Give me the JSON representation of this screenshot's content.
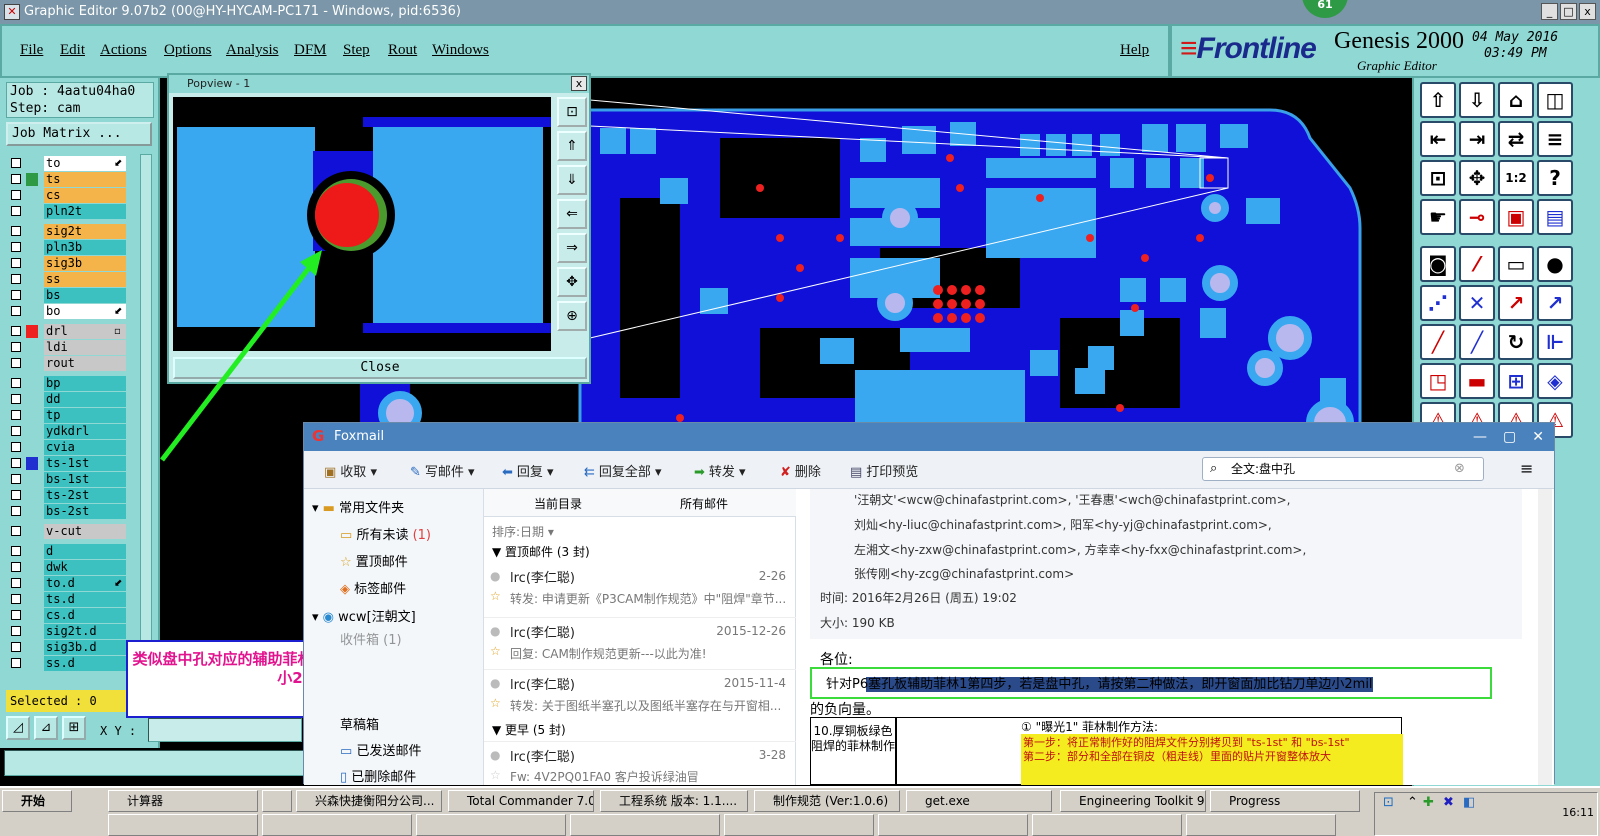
{
  "window": {
    "title": "Graphic Editor 9.07b2 (00@HY-HYCAM-PC171 - Windows, pid:6536)",
    "badge": "61",
    "controls": [
      "_",
      "□",
      "x"
    ]
  },
  "menu": {
    "items": [
      "File",
      "Edit",
      "Actions",
      "Options",
      "Analysis",
      "DFM",
      "Step",
      "Rout",
      "Windows"
    ],
    "help": "Help"
  },
  "brand": {
    "logo_main": "Frontline",
    "product": "Genesis 2000",
    "subtitle": "Graphic Editor",
    "date": "04 May 2016",
    "time": "03:49 PM"
  },
  "left": {
    "job": "Job : 4aatu04ha0",
    "step": "Step: cam",
    "job_matrix": "Job Matrix ...",
    "layers": [
      {
        "name": "to",
        "bg": "#ffffff",
        "swatch": "",
        "mark": "⬋"
      },
      {
        "name": "ts",
        "bg": "#f4b44a",
        "swatch": "#2e9a46",
        "mark": ""
      },
      {
        "name": "cs",
        "bg": "#f4b44a",
        "swatch": "",
        "mark": ""
      },
      {
        "name": "pln2t",
        "bg": "#3cc0c0",
        "swatch": "",
        "mark": ""
      },
      {
        "name": "sig2t",
        "bg": "#f4b44a",
        "swatch": "",
        "mark": ""
      },
      {
        "name": "pln3b",
        "bg": "#3cc0c0",
        "swatch": "",
        "mark": ""
      },
      {
        "name": "sig3b",
        "bg": "#f4b44a",
        "swatch": "",
        "mark": ""
      },
      {
        "name": "ss",
        "bg": "#f4b44a",
        "swatch": "",
        "mark": ""
      },
      {
        "name": "bs",
        "bg": "#3cc0c0",
        "swatch": "",
        "mark": ""
      },
      {
        "name": "bo",
        "bg": "#ffffff",
        "swatch": "",
        "mark": "⬋"
      },
      {
        "name": "drl",
        "bg": "#c8c8c8",
        "swatch": "#ee2020",
        "mark": "▫"
      },
      {
        "name": "ldi",
        "bg": "#c8c8c8",
        "swatch": "",
        "mark": ""
      },
      {
        "name": "rout",
        "bg": "#c8c8c8",
        "swatch": "",
        "mark": ""
      },
      {
        "name": "bp",
        "bg": "#3cc0c0",
        "swatch": "",
        "mark": ""
      },
      {
        "name": "dd",
        "bg": "#3cc0c0",
        "swatch": "",
        "mark": ""
      },
      {
        "name": "tp",
        "bg": "#3cc0c0",
        "swatch": "",
        "mark": ""
      },
      {
        "name": "ydkdrl",
        "bg": "#3cc0c0",
        "swatch": "",
        "mark": ""
      },
      {
        "name": "cvia",
        "bg": "#3cc0c0",
        "swatch": "",
        "mark": ""
      },
      {
        "name": "ts-1st",
        "bg": "#3cc0c0",
        "swatch": "#2030d0",
        "mark": ""
      },
      {
        "name": "bs-1st",
        "bg": "#3cc0c0",
        "swatch": "",
        "mark": ""
      },
      {
        "name": "ts-2st",
        "bg": "#3cc0c0",
        "swatch": "",
        "mark": ""
      },
      {
        "name": "bs-2st",
        "bg": "#3cc0c0",
        "swatch": "",
        "mark": ""
      },
      {
        "name": "v-cut",
        "bg": "#c8c8c8",
        "swatch": "",
        "mark": ""
      },
      {
        "name": "d",
        "bg": "#3cc0c0",
        "swatch": "",
        "mark": ""
      },
      {
        "name": "dwk",
        "bg": "#3cc0c0",
        "swatch": "",
        "mark": ""
      },
      {
        "name": "to.d",
        "bg": "#3cc0c0",
        "swatch": "",
        "mark": "⬋"
      },
      {
        "name": "ts.d",
        "bg": "#3cc0c0",
        "swatch": "",
        "mark": ""
      },
      {
        "name": "cs.d",
        "bg": "#3cc0c0",
        "swatch": "",
        "mark": ""
      },
      {
        "name": "sig2t.d",
        "bg": "#3cc0c0",
        "swatch": "",
        "mark": ""
      },
      {
        "name": "sig3b.d",
        "bg": "#3cc0c0",
        "swatch": "",
        "mark": ""
      },
      {
        "name": "ss.d",
        "bg": "#3cc0c0",
        "swatch": "",
        "mark": ""
      }
    ],
    "selected": "Selected : 0",
    "xy_label": "X Y :"
  },
  "popview": {
    "title": "Popview - 1",
    "close_x": "x",
    "close_button": "Close"
  },
  "annotation": {
    "text": "类似盘中孔对应的辅助菲林应该是掏比钻刀单边小2"
  },
  "foxmail": {
    "title": "Foxmail",
    "toolbar": [
      "收取",
      "写邮件",
      "回复",
      "回复全部",
      "转发",
      "删除",
      "打印预览"
    ],
    "search": "全文:盘中孔",
    "folders": [
      {
        "label": "常用文件夹",
        "count": ""
      },
      {
        "label": "所有未读",
        "count": "(1)"
      },
      {
        "label": "置顶邮件",
        "count": ""
      },
      {
        "label": "标签邮件",
        "count": ""
      },
      {
        "label": "wcw[汪朝文]",
        "count": ""
      },
      {
        "label": "收件箱",
        "count": "(1)"
      },
      {
        "label": "草稿箱",
        "count": ""
      },
      {
        "label": "已发送邮件",
        "count": ""
      },
      {
        "label": "已删除邮件",
        "count": ""
      }
    ],
    "tabs": [
      "当前目录",
      "所有邮件"
    ],
    "sort": "排序:日期",
    "group1": "置顶邮件 (3 封)",
    "group2": "更早 (5 封)",
    "messages": [
      {
        "from": "lrc(李仁聪)",
        "date": "2-26",
        "subject": "转发: 申请更新《P3CAM制作规范》中\"阻焊\"章节..."
      },
      {
        "from": "lrc(李仁聪)",
        "date": "2015-12-26",
        "subject": "回复: CAM制作规范更新---以此为准!"
      },
      {
        "from": "lrc(李仁聪)",
        "date": "2015-11-4",
        "subject": "转发: 关于图纸半塞孔以及图纸半塞存在与开窗相..."
      },
      {
        "from": "lrc(李仁聪)",
        "date": "3-28",
        "subject": "Fw: 4V2PQ01FA0 客户投诉绿油冒"
      }
    ],
    "reading": {
      "to_lines": [
        "'汪朝文'<wcw@chinafastprint.com>, '王春惠'<wch@chinafastprint.com>,",
        "刘灿<hy-liuc@chinafastprint.com>, 阳军<hy-yj@chinafastprint.com>,",
        "左湘文<hy-zxw@chinafastprint.com>, 方幸幸<hy-fxx@chinafastprint.com>,",
        "张传刚<hy-zcg@chinafastprint.com>"
      ],
      "time_label": "时间:",
      "time": "2016年2月26日 (周五) 19:02",
      "size_label": "大小:",
      "size": "190 KB",
      "greeting": "各位:",
      "body": "针对P6塞孔板辅助菲林1第四步，若是盘中孔，请按第二种做法，即开窗面加比钻刀单边小2mil",
      "body2": "的负向量。",
      "table_left": "10.厚铜板绿色阻焊的菲林制作",
      "table_head": "① \"曝光1\" 菲林制作方法:",
      "step1": "第一步：将正常制作好的阻焊文件分别拷贝到 \"ts-1st\" 和 \"bs-1st\"",
      "step2": "第二步：部分和全部在铜皮（粗走线）里面的贴片开窗整体放大"
    }
  },
  "taskbar": {
    "start": "开始",
    "buttons": [
      "计算器",
      "",
      "兴森快捷衡阳分公司...",
      "Total Commander 7.0 p...",
      "工程系统  版本: 1.1....",
      "制作规范 (Ver:1.0.6)",
      "get.exe",
      "Engineering Toolkit 9.0...",
      "Progress"
    ],
    "clock": "16:11"
  }
}
